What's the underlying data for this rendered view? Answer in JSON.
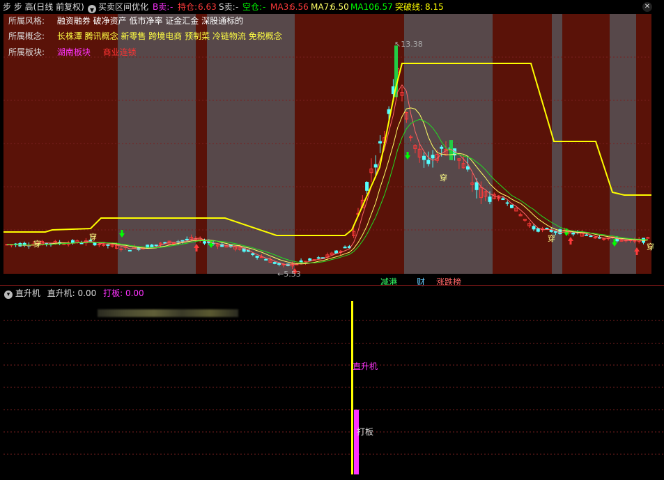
{
  "header": {
    "title": "步 步 高(日线 前复权)",
    "indicator": "买卖区间优化",
    "b_sell_label": "B卖:",
    "b_sell_value": "-",
    "hold_label": "持仓:",
    "hold_value": "6.63",
    "s_sell_label": "S卖:",
    "s_sell_value": "-",
    "empty_label": "空仓:",
    "empty_value": "-",
    "ma3_label": "MA3:",
    "ma3_value": "6.56",
    "ma7_label": "MA7:",
    "ma7_value": "6.50",
    "ma10_label": "MA10:",
    "ma10_value": "6.57",
    "break_label": "突破线:",
    "break_value": "8.15",
    "close_icon": "close-icon"
  },
  "info": {
    "style_label": "所属风格:",
    "style_value": "融资融券 破净资产 低市净率 证金汇金 深股通标的",
    "concept_label": "所属概念:",
    "concept_value": "长株潭 腾讯概念 新零售 跨境电商 预制菜 冷链物流 免税概念",
    "sector_label": "所属板块:",
    "sector_value1": "湖南板块",
    "sector_value2": "商业连锁"
  },
  "chart_annotations": {
    "high_label": "13.38",
    "low_label": "5.53",
    "chuan_label": "穿"
  },
  "event_tags": {
    "tag1": "减港",
    "tag2": "财",
    "tag3": "涨跌榜"
  },
  "sub": {
    "name": "直升机",
    "line1_label": "直升机:",
    "line1_value": "0.00",
    "line2_label": "打板:",
    "line2_value": "0.00",
    "bar1_label": "直升机",
    "bar2_label": "打板"
  },
  "colors": {
    "up": "#ff3b3b",
    "down": "#54ffff",
    "yellow": "#ffff00",
    "magenta": "#ff33ff",
    "green": "#00ff00",
    "bg_red": "#5a1208",
    "bg_gray": "#57484a"
  },
  "chart_data": {
    "type": "candlestick",
    "high_price": 13.38,
    "low_price": 5.53,
    "series": [
      {
        "name": "MA3",
        "value": 6.56
      },
      {
        "name": "MA7",
        "value": 6.5
      },
      {
        "name": "MA10",
        "value": 6.57
      },
      {
        "name": "突破线",
        "value": 8.15
      }
    ]
  }
}
